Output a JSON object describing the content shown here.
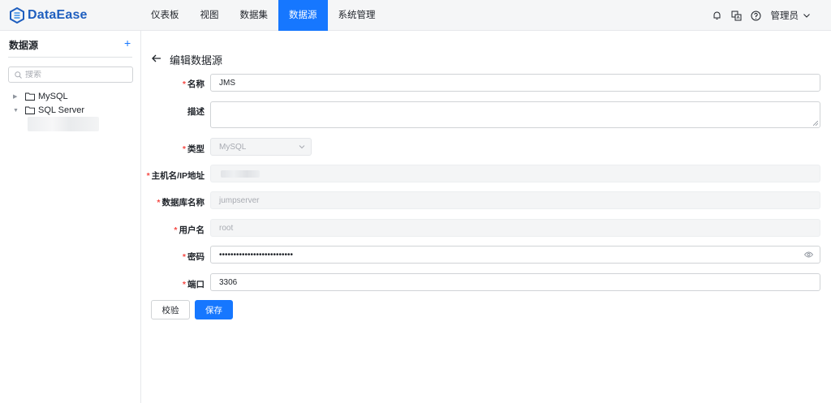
{
  "brand": {
    "name": "DataEase",
    "color": "#1f5fbf",
    "accent": "#1677ff"
  },
  "nav": {
    "items": [
      {
        "label": "仪表板",
        "active": false
      },
      {
        "label": "视图",
        "active": false
      },
      {
        "label": "数据集",
        "active": false
      },
      {
        "label": "数据源",
        "active": true
      },
      {
        "label": "系统管理",
        "active": false
      }
    ]
  },
  "header_right": {
    "icons": [
      "notification-icon",
      "translate-icon",
      "help-icon"
    ],
    "user": "管理员"
  },
  "sidebar": {
    "title": "数据源",
    "add_label": "+",
    "search_placeholder": "搜索",
    "tree": [
      {
        "label": "MySQL",
        "expanded": false
      },
      {
        "label": "SQL Server",
        "expanded": true
      }
    ]
  },
  "form": {
    "title": "编辑数据源",
    "back_icon": "arrow-left-icon",
    "fields": {
      "name": {
        "label": "名称",
        "required": true,
        "value": "JMS"
      },
      "description": {
        "label": "描述",
        "required": false,
        "value": ""
      },
      "type": {
        "label": "类型",
        "required": true,
        "value": "MySQL"
      },
      "host": {
        "label": "主机名/IP地址",
        "required": true,
        "value": ""
      },
      "database": {
        "label": "数据库名称",
        "required": true,
        "value": "jumpserver"
      },
      "username": {
        "label": "用户名",
        "required": true,
        "value": "root"
      },
      "password": {
        "label": "密码",
        "required": true,
        "value": "••••••••••••••••••••••••••"
      },
      "port": {
        "label": "端口",
        "required": true,
        "value": "3306"
      }
    },
    "buttons": {
      "validate": "校验",
      "save": "保存"
    }
  }
}
